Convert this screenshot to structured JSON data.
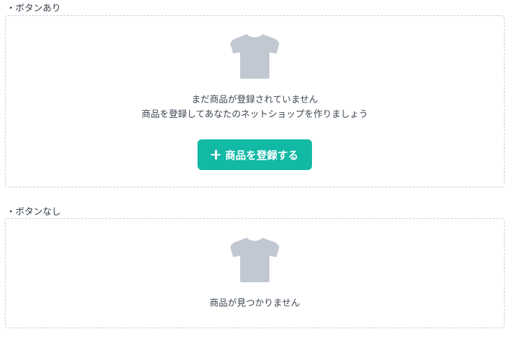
{
  "sections": [
    {
      "label": "・ボタンあり",
      "empty_state": {
        "icon": "tshirt-icon",
        "message_line1": "まだ商品が登録されていません",
        "message_line2": "商品を登録してあなたのネットショップを作りましょう",
        "button_label": "商品を登録する",
        "button_icon": "plus-icon"
      }
    },
    {
      "label": "・ボタンなし",
      "empty_state": {
        "icon": "tshirt-icon",
        "message_line1": "商品が見つかりません"
      }
    }
  ],
  "colors": {
    "accent": "#12b9a5",
    "icon_gray": "#c2c8d2",
    "text": "#3d4653",
    "border": "#c8cdd4"
  }
}
